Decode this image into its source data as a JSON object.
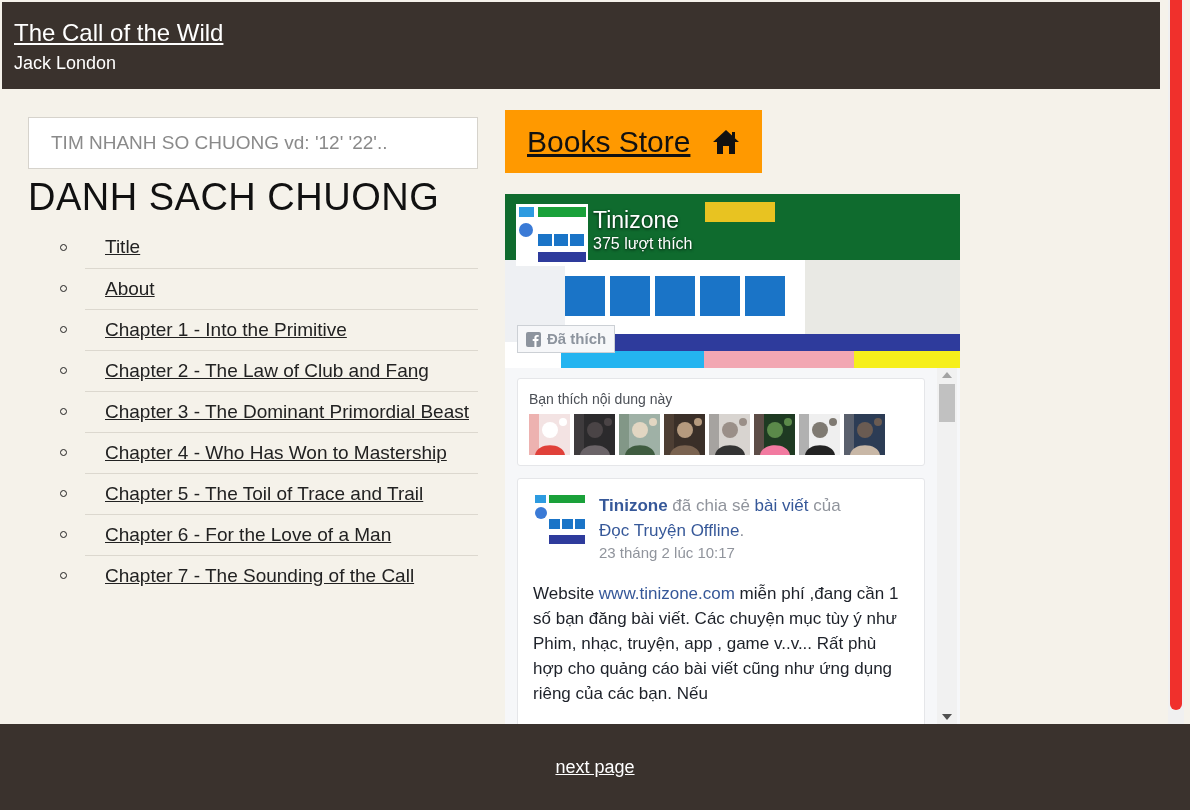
{
  "header": {
    "title": "The Call of the Wild",
    "author": "Jack London"
  },
  "search": {
    "placeholder": "TIM NHANH SO CHUONG vd: '12' '22'.."
  },
  "chapters_heading": "DANH SACH CHUONG",
  "chapters": [
    {
      "label": "Title"
    },
    {
      "label": "About"
    },
    {
      "label": "Chapter 1 - Into the Primitive"
    },
    {
      "label": "Chapter 2 - The Law of Club and Fang"
    },
    {
      "label": "Chapter 3 - The Dominant Primordial Beast"
    },
    {
      "label": "Chapter 4 - Who Has Won to Mastership"
    },
    {
      "label": "Chapter 5 - The Toil of Trace and Trail"
    },
    {
      "label": "Chapter 6 - For the Love of a Man"
    },
    {
      "label": "Chapter 7 - The Sounding of the Call"
    }
  ],
  "store_button": {
    "label": "Books Store"
  },
  "facebook": {
    "page_name": "Tinizone",
    "likes": "375 lượt thích",
    "like_button": "Đã thích",
    "friends_label": "Bạn thích nội dung này",
    "post": {
      "heading": [
        {
          "kind": "author",
          "text": "Tinizone"
        },
        {
          "kind": "plain",
          "text": " đã chia sẻ "
        },
        {
          "kind": "link",
          "text": "bài viết"
        },
        {
          "kind": "plain",
          "text": " của "
        },
        {
          "kind": "link",
          "text": "Đọc Truyện Offline"
        },
        {
          "kind": "plain",
          "text": "."
        }
      ],
      "date": "23 tháng 2 lúc 10:17",
      "body": [
        {
          "kind": "plain",
          "text": "Website "
        },
        {
          "kind": "link",
          "text": "www.tinizone.com"
        },
        {
          "kind": "plain",
          "text": " miễn phí ,đang cần 1 số bạn đăng bài viết. Các chuyện mục tùy ý như Phim, nhạc, truyện, app , game v..v... Rất phù hợp cho quảng cáo bài viết cũng như ứng dụng riêng của các bạn. Nếu"
        }
      ]
    }
  },
  "footer": {
    "next_page": "next page"
  }
}
